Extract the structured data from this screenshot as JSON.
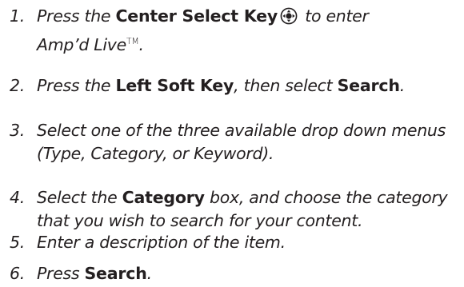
{
  "steps": [
    {
      "num": "1.",
      "a": "Press the ",
      "b": "Center Select Key",
      "c": " to enter",
      "line2a": "Amp’d Live",
      "line2tm": "TM",
      "line2b": ".",
      "icon": "center-select-key-icon"
    },
    {
      "num": "2.",
      "a": "Press the ",
      "b": "Left Soft Key",
      "c": ", then select ",
      "d": "Search",
      "e": "."
    },
    {
      "num": "3.",
      "line1": "Select one of the three available drop down menus",
      "line2": "(Type, Category, or Keyword)."
    },
    {
      "num": "4.",
      "a": "Select the ",
      "b": "Category",
      "c": " box, and choose the category",
      "line2": "that you wish to search for your content."
    },
    {
      "num": "5.",
      "line1": "Enter a description of the item."
    },
    {
      "num": "6.",
      "a": "Press ",
      "b": "Search",
      "c": "."
    }
  ],
  "colors": {
    "text": "#231f20"
  }
}
